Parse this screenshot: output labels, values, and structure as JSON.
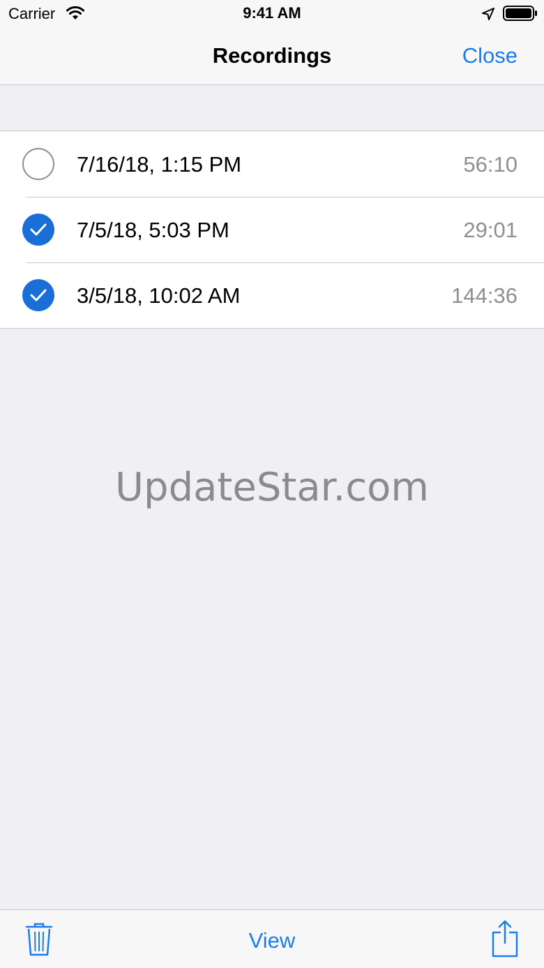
{
  "status_bar": {
    "carrier": "Carrier",
    "time": "9:41 AM",
    "icons": [
      "wifi-icon",
      "location-arrow-icon",
      "battery-icon"
    ]
  },
  "nav": {
    "title": "Recordings",
    "close_label": "Close"
  },
  "recordings": [
    {
      "date": "7/16/18, 1:15 PM",
      "duration": "56:10",
      "selected": false
    },
    {
      "date": "7/5/18, 5:03 PM",
      "duration": "29:01",
      "selected": true
    },
    {
      "date": "3/5/18, 10:02 AM",
      "duration": "144:36",
      "selected": true
    }
  ],
  "watermark": "UpdateStar.com",
  "toolbar": {
    "view_label": "View",
    "icons": [
      "trash-icon",
      "share-icon"
    ]
  },
  "colors": {
    "accent": "#1a7cf0",
    "checkmark_fill": "#1a6fd6",
    "background": "#efeff4",
    "secondary_text": "#8e8e93"
  }
}
